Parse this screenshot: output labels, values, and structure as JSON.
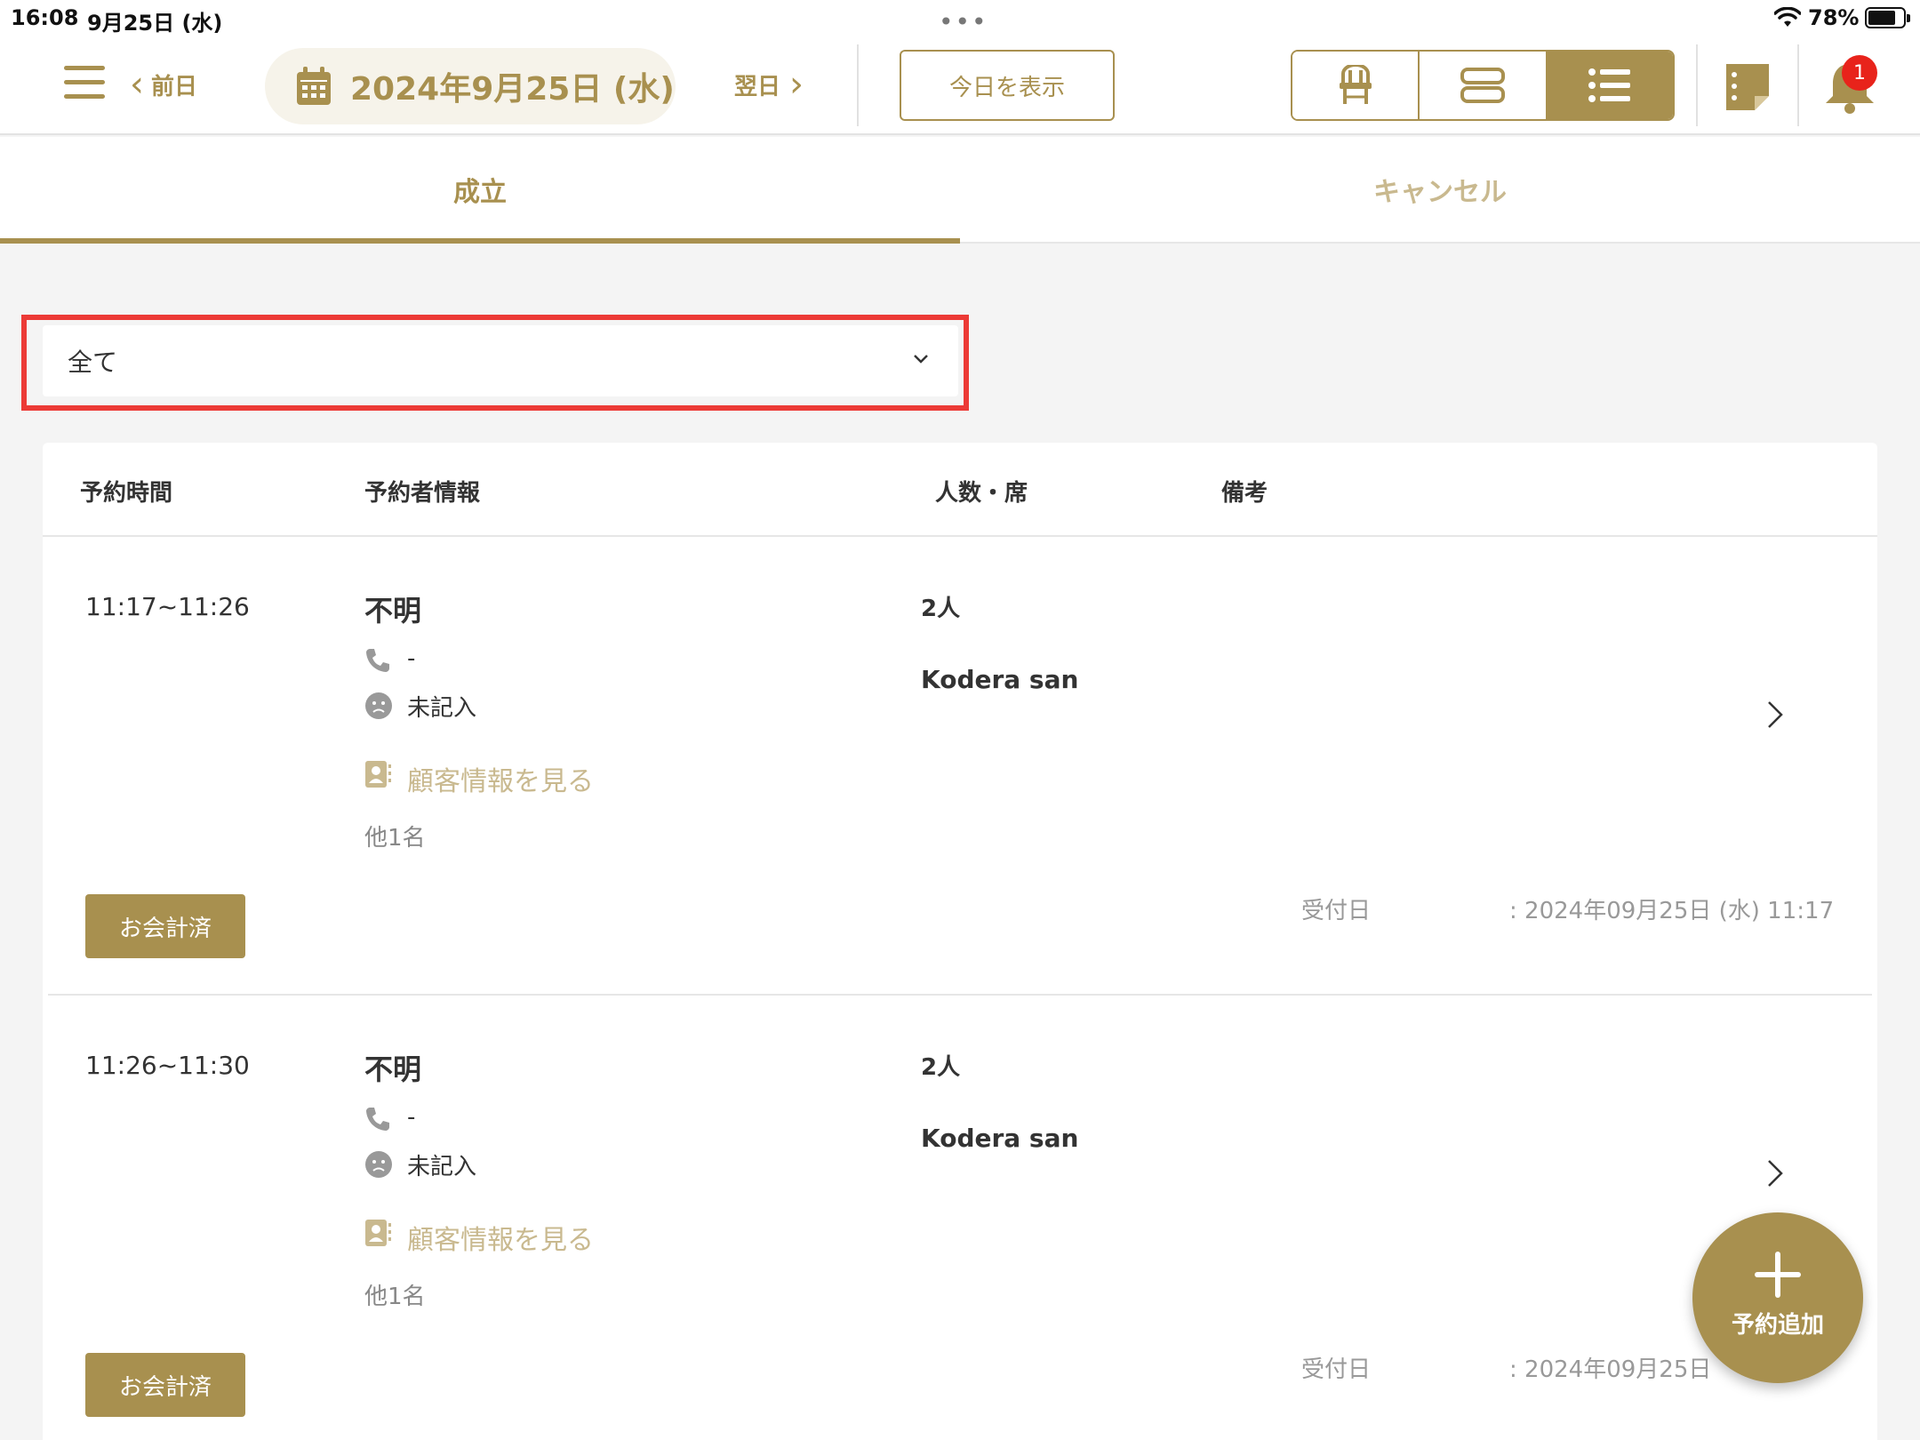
{
  "status_bar": {
    "time": "16:08",
    "date": "9月25日 (水)",
    "dots": "•••",
    "battery": "78%"
  },
  "toolbar": {
    "prev_label": "前日",
    "date_title": "2024年9月25日 (水)",
    "next_label": "翌日",
    "today_label": "今日を表示",
    "view_icons": [
      "chair-icon",
      "table-rows-icon",
      "list-icon"
    ],
    "active_view": "list-icon",
    "notification_count": "1"
  },
  "tabs": [
    {
      "label": "成立",
      "active": true
    },
    {
      "label": "キャンセル",
      "active": false
    }
  ],
  "filter": {
    "value": "全て"
  },
  "table": {
    "headers": [
      "予約時間",
      "予約者情報",
      "人数・席",
      "備考"
    ],
    "rows": [
      {
        "time": "11:17~11:26",
        "name": "不明",
        "phone": "-",
        "unfilled": "未記入",
        "customer_link": "顧客情報を見る",
        "others": "他1名",
        "people": "2人",
        "staff": "Kodera san",
        "status_button": "お会計済",
        "received_label": "受付日",
        "received_value": ": 2024年09月25日 (水) 11:17"
      },
      {
        "time": "11:26~11:30",
        "name": "不明",
        "phone": "-",
        "unfilled": "未記入",
        "customer_link": "顧客情報を見る",
        "others": "他1名",
        "people": "2人",
        "staff": "Kodera san",
        "status_button": "お会計済",
        "received_label": "受付日",
        "received_value": ": 2024年09月25日"
      }
    ]
  },
  "fab": {
    "label": "予約追加"
  },
  "colors": {
    "accent": "#a8904f",
    "accent_light": "#c9b98f",
    "highlight": "#ec3a36",
    "badge": "#e8231b"
  }
}
